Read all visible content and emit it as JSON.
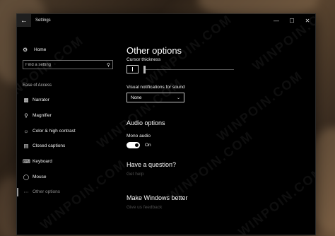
{
  "window": {
    "title": "Settings",
    "controls": {
      "minimize": "—",
      "maximize": "☐",
      "close": "✕"
    }
  },
  "sidebar": {
    "home_label": "Home",
    "search_placeholder": "Find a setting",
    "section_label": "Ease of Access",
    "items": [
      {
        "label": "Narrator",
        "icon": "narrator-icon"
      },
      {
        "label": "Magnifier",
        "icon": "magnifier-icon"
      },
      {
        "label": "Color & high contrast",
        "icon": "brightness-icon"
      },
      {
        "label": "Closed captions",
        "icon": "captions-icon"
      },
      {
        "label": "Keyboard",
        "icon": "keyboard-icon"
      },
      {
        "label": "Mouse",
        "icon": "mouse-icon"
      },
      {
        "label": "Other options",
        "icon": "other-options-icon",
        "selected": true
      }
    ]
  },
  "main": {
    "title": "Other options",
    "cursor_thickness_label": "Cursor thickness",
    "cursor_thickness_value": 1,
    "visual_notifications_label": "Visual notifications for sound",
    "visual_notifications_value": "None",
    "audio_section_title": "Audio options",
    "mono_audio_label": "Mono audio",
    "mono_audio_state": "On",
    "question_title": "Have a question?",
    "get_help_link": "Get help",
    "better_title": "Make Windows better",
    "feedback_link": "Give us feedback"
  },
  "watermark_text": "WINPOIN.COM"
}
